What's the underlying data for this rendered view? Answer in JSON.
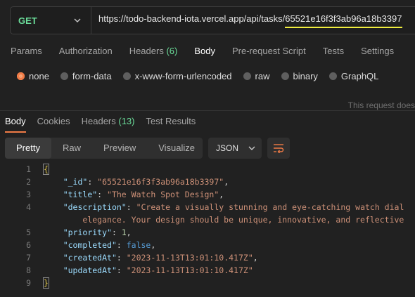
{
  "request": {
    "method": "GET",
    "url_base": "https://todo-backend-iota.vercel.app/api/tasks/",
    "url_id": "65521e16f3f3ab96a18b3397"
  },
  "request_tabs": {
    "params": "Params",
    "authorization": "Authorization",
    "headers": "Headers",
    "headers_count": "(6)",
    "body": "Body",
    "prerequest": "Pre-request Script",
    "tests": "Tests",
    "settings": "Settings"
  },
  "body_types": {
    "none": "none",
    "form_data": "form-data",
    "urlencoded": "x-www-form-urlencoded",
    "raw": "raw",
    "binary": "binary",
    "graphql": "GraphQL"
  },
  "notice": "This request does",
  "response_tabs": {
    "body": "Body",
    "cookies": "Cookies",
    "headers": "Headers",
    "headers_count": "(13)",
    "test_results": "Test Results"
  },
  "view_modes": {
    "pretty": "Pretty",
    "raw": "Raw",
    "preview": "Preview",
    "visualize": "Visualize"
  },
  "format": "JSON",
  "lines": {
    "n": [
      "1",
      "2",
      "3",
      "4",
      "",
      "5",
      "6",
      "7",
      "8",
      "9"
    ],
    "open": "{",
    "close": "}",
    "id_key": "\"_id\"",
    "id_val": "\"65521e16f3f3ab96a18b3397\"",
    "title_key": "\"title\"",
    "title_val": "\"The Watch Spot Design\"",
    "desc_key": "\"description\"",
    "desc_val_1": "\"Create a visually stunning and eye-catching watch dial",
    "desc_val_2": "elegance. Your design should be unique, innovative, and reflective",
    "priority_key": "\"priority\"",
    "priority_val": "1",
    "completed_key": "\"completed\"",
    "completed_val": "false",
    "created_key": "\"createdAt\"",
    "created_val": "\"2023-11-13T13:01:10.417Z\"",
    "updated_key": "\"updatedAt\"",
    "updated_val": "\"2023-11-13T13:01:10.417Z\""
  },
  "icons": {
    "chevron": "chevron-down-icon",
    "wrap": "wrap-lines-icon"
  },
  "colors": {
    "accent": "#f07b46",
    "get_method": "#6bdd9a",
    "url_highlight": "#f0ed3e"
  }
}
